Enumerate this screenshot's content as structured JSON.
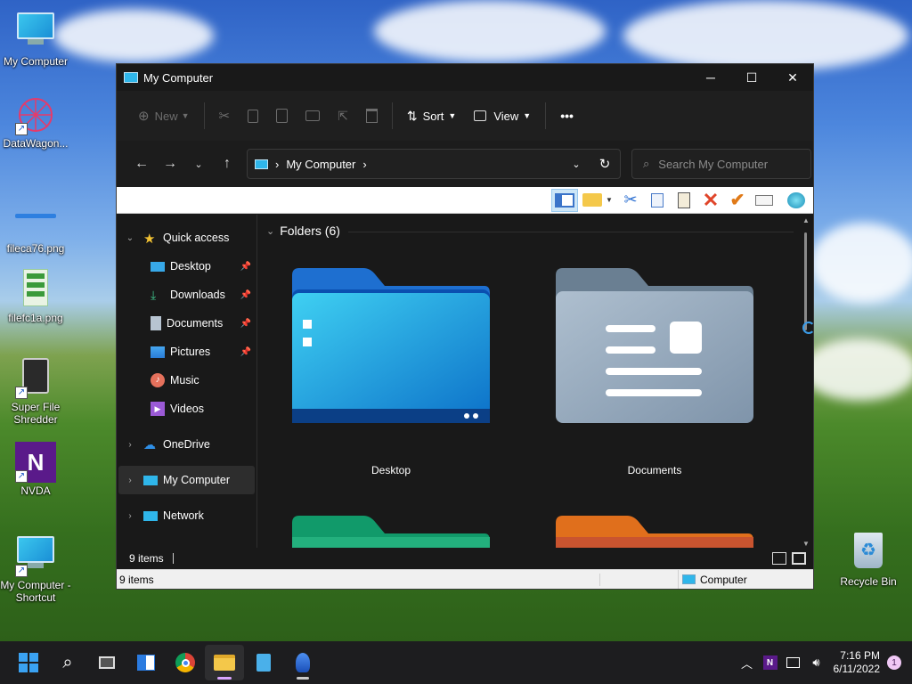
{
  "desktop": {
    "icons": [
      {
        "label": "My Computer"
      },
      {
        "label": "DataWagon..."
      },
      {
        "label": "fileca76.png"
      },
      {
        "label": "filefc1a.png"
      },
      {
        "label": "Super File Shredder"
      },
      {
        "label": "NVDA"
      },
      {
        "label": "My Computer - Shortcut"
      },
      {
        "label": "Recycle Bin"
      }
    ]
  },
  "window": {
    "title": "My Computer",
    "controls": {
      "minimize": "─",
      "maximize": "☐",
      "close": "✕"
    },
    "toolbar": {
      "new_label": "New",
      "sort_label": "Sort",
      "view_label": "View",
      "more_label": "•••"
    },
    "address": {
      "path": "My Computer",
      "search_placeholder": "Search My Computer"
    },
    "navpane": {
      "quick_access": "Quick access",
      "items": [
        {
          "label": "Desktop"
        },
        {
          "label": "Downloads"
        },
        {
          "label": "Documents"
        },
        {
          "label": "Pictures"
        },
        {
          "label": "Music"
        },
        {
          "label": "Videos"
        }
      ],
      "onedrive": "OneDrive",
      "mycomputer": "My Computer",
      "network": "Network"
    },
    "content": {
      "group_header": "Folders (6)",
      "folders": [
        {
          "label": "Desktop"
        },
        {
          "label": "Documents"
        }
      ]
    },
    "status": {
      "items_count": "9 items",
      "legacy_count": "9 items",
      "legacy_location": "Computer"
    }
  },
  "taskbar": {
    "clock_time": "7:16 PM",
    "clock_date": "6/11/2022",
    "notification_count": "1"
  }
}
